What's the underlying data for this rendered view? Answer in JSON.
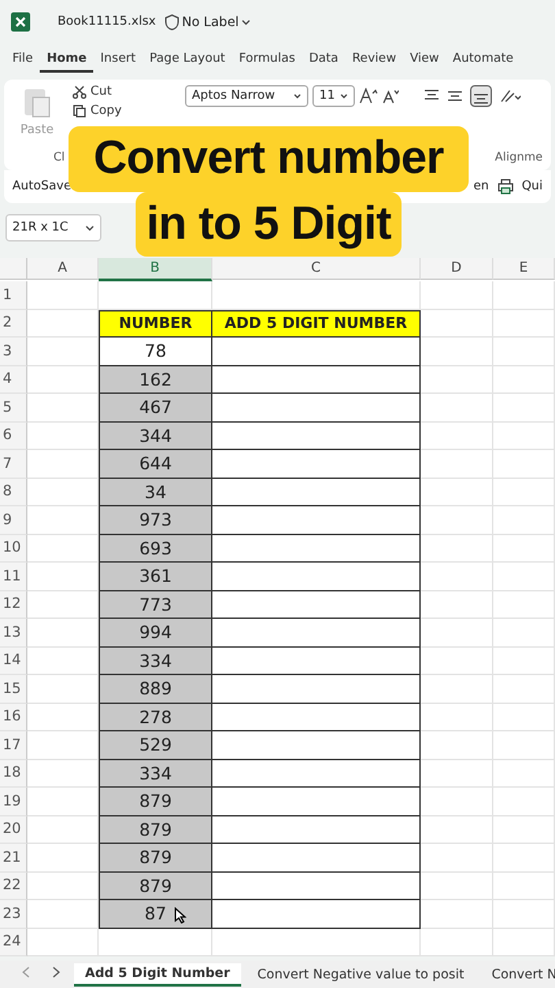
{
  "title_bar": {
    "file_name": "Book11115.xlsx",
    "label": "No Label"
  },
  "menu_tabs": [
    {
      "label": "File",
      "selected": false
    },
    {
      "label": "Home",
      "selected": true
    },
    {
      "label": "Insert",
      "selected": false
    },
    {
      "label": "Page Layout",
      "selected": false
    },
    {
      "label": "Formulas",
      "selected": false
    },
    {
      "label": "Data",
      "selected": false
    },
    {
      "label": "Review",
      "selected": false
    },
    {
      "label": "View",
      "selected": false
    },
    {
      "label": "Automate",
      "selected": false
    }
  ],
  "ribbon": {
    "paste": "Paste",
    "cut": "Cut",
    "copy": "Copy",
    "font": "Aptos Narrow",
    "font_size": "11",
    "group_clipboard": "Cl",
    "group_alignment": "Alignme"
  },
  "quick_bar": {
    "autosave": "AutoSave",
    "item_right_1": "en",
    "item_right_2": "Qui"
  },
  "name_box": "21R x 1C",
  "overlay_caption": [
    "Convert number",
    "in to 5 Digit"
  ],
  "columns": [
    {
      "label": "A",
      "selected": false
    },
    {
      "label": "B",
      "selected": true
    },
    {
      "label": "C",
      "selected": false
    },
    {
      "label": "D",
      "selected": false
    },
    {
      "label": "E",
      "selected": false
    }
  ],
  "headers": [
    "NUMBER",
    "ADD 5 DIGIT NUMBER"
  ],
  "rows": [
    {
      "number": "78",
      "selected": false
    },
    {
      "number": "162",
      "selected": true
    },
    {
      "number": "467",
      "selected": true
    },
    {
      "number": "344",
      "selected": true
    },
    {
      "number": "644",
      "selected": true
    },
    {
      "number": "34",
      "selected": true
    },
    {
      "number": "973",
      "selected": true
    },
    {
      "number": "693",
      "selected": true
    },
    {
      "number": "361",
      "selected": true
    },
    {
      "number": "773",
      "selected": true
    },
    {
      "number": "994",
      "selected": true
    },
    {
      "number": "334",
      "selected": true
    },
    {
      "number": "889",
      "selected": true
    },
    {
      "number": "278",
      "selected": true
    },
    {
      "number": "529",
      "selected": true
    },
    {
      "number": "334",
      "selected": true
    },
    {
      "number": "879",
      "selected": true
    },
    {
      "number": "879",
      "selected": true
    },
    {
      "number": "879",
      "selected": true
    },
    {
      "number": "879",
      "selected": true
    },
    {
      "number": "87",
      "selected": true
    }
  ],
  "row_numbers": [
    "1",
    "2",
    "3",
    "4",
    "5",
    "6",
    "7",
    "8",
    "9",
    "10",
    "11",
    "12",
    "13",
    "14",
    "15",
    "16",
    "17",
    "18",
    "19",
    "20",
    "21",
    "22",
    "23",
    "24"
  ],
  "sheet_tabs": [
    {
      "label": "Add 5 Digit Number",
      "selected": true
    },
    {
      "label": "Convert Negative value to posit",
      "selected": false
    },
    {
      "label": "Convert N",
      "selected": false
    }
  ]
}
